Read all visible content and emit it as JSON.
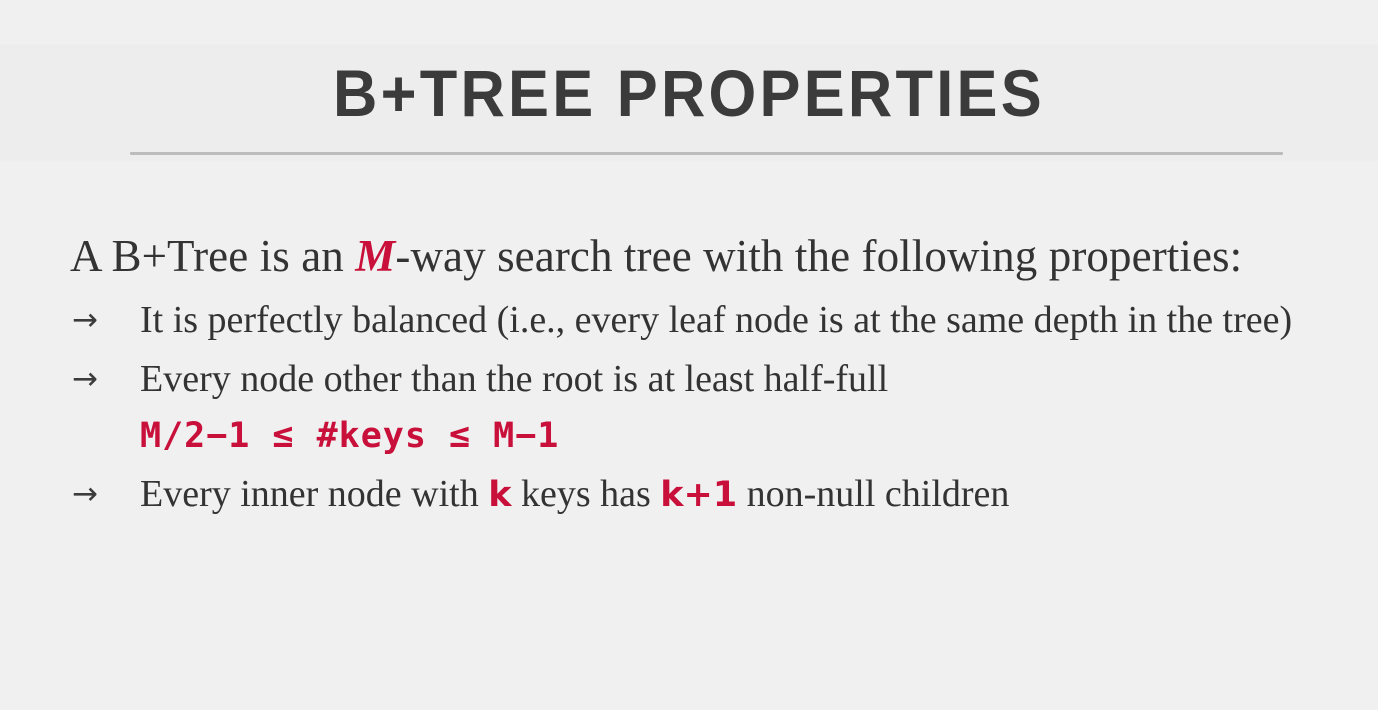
{
  "slide": {
    "title": "B+TREE PROPERTIES",
    "background_color": "#eeeeee",
    "text_color": "#333333",
    "accent_color": "#c8103a",
    "rule_color": "#bcbcbc"
  },
  "lead": {
    "before_accent": "A B+Tree is an ",
    "accent": "M",
    "after_accent": "-way search tree with the following properties:"
  },
  "bullets": [
    {
      "marker": "→",
      "text": "It is perfectly balanced (i.e., every leaf node is at the same depth in the tree)"
    },
    {
      "marker": "→",
      "text": "Every node other than the root is at least half-full"
    },
    {
      "marker": "→",
      "segments": [
        {
          "text": "Every inner node with ",
          "style": "plain"
        },
        {
          "text": "k",
          "style": "mono-red"
        },
        {
          "text": " keys has ",
          "style": "plain"
        },
        {
          "text": "k+1",
          "style": "mono-red"
        },
        {
          "text": " non-null children",
          "style": "plain"
        }
      ]
    }
  ],
  "formula": "M/2−1  ≤  #keys  ≤  M−1"
}
